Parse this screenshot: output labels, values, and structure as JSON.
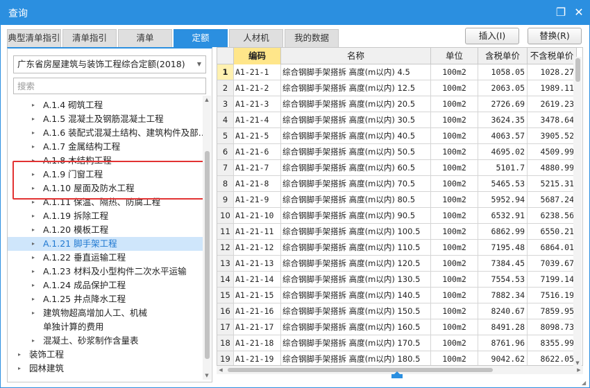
{
  "window": {
    "title": "查询",
    "restore_glyph": "❐",
    "close_glyph": "✕"
  },
  "tabs": [
    {
      "label": "典型清单指引",
      "active": false
    },
    {
      "label": "清单指引",
      "active": false
    },
    {
      "label": "清单",
      "active": false
    },
    {
      "label": "定额",
      "active": true
    },
    {
      "label": "人材机",
      "active": false
    },
    {
      "label": "我的数据",
      "active": false
    }
  ],
  "toolbar": {
    "insert_label": "插入(I)",
    "replace_label": "替换(R)"
  },
  "left": {
    "quota_library": "广东省房屋建筑与装饰工程综合定额(2018)",
    "search_placeholder": "搜索",
    "tree": [
      {
        "label": "A.1.4 砌筑工程",
        "caret": "▸",
        "indent": 1
      },
      {
        "label": "A.1.5 混凝土及钢筋混凝土工程",
        "caret": "▸",
        "indent": 1
      },
      {
        "label": "A.1.6 装配式混凝土结构、建筑构件及部…",
        "caret": "▸",
        "indent": 1
      },
      {
        "label": "A.1.7 金属结构工程",
        "caret": "▸",
        "indent": 1
      },
      {
        "label": "A.1.8 木结构工程",
        "caret": "▸",
        "indent": 1
      },
      {
        "label": "A.1.9 门窗工程",
        "caret": "▸",
        "indent": 1
      },
      {
        "label": "A.1.10 屋面及防水工程",
        "caret": "▸",
        "indent": 1
      },
      {
        "label": "A.1.11 保温、隔热、防腐工程",
        "caret": "▸",
        "indent": 1
      },
      {
        "label": "A.1.19 拆除工程",
        "caret": "▸",
        "indent": 1
      },
      {
        "label": "A.1.20 模板工程",
        "caret": "▸",
        "indent": 1
      },
      {
        "label": "A.1.21 脚手架工程",
        "caret": "▸",
        "indent": 1,
        "selected": true
      },
      {
        "label": "A.1.22 垂直运输工程",
        "caret": "▸",
        "indent": 1
      },
      {
        "label": "A.1.23 材料及小型构件二次水平运输",
        "caret": "▸",
        "indent": 1
      },
      {
        "label": "A.1.24 成品保护工程",
        "caret": "▸",
        "indent": 1
      },
      {
        "label": "A.1.25 井点降水工程",
        "caret": "▸",
        "indent": 1
      },
      {
        "label": "建筑物超高增加人工、机械",
        "caret": "▸",
        "indent": 1
      },
      {
        "label": "单独计算的费用",
        "caret": "",
        "indent": 1
      },
      {
        "label": "混凝土、砂浆制作含量表",
        "caret": "▸",
        "indent": 1
      },
      {
        "label": "装饰工程",
        "caret": "▸",
        "indent": 0
      },
      {
        "label": "园林建筑",
        "caret": "▸",
        "indent": 0
      }
    ]
  },
  "grid": {
    "columns": [
      "",
      "编码",
      "名称",
      "单位",
      "含税单价",
      "不含税单价"
    ],
    "rows": [
      {
        "n": "1",
        "code": "A1-21-1",
        "name": "综合钢脚手架搭拆 高度(m以内) 4.5",
        "unit": "100m2",
        "tax": "1058.05",
        "notax": "1028.27",
        "active": true
      },
      {
        "n": "2",
        "code": "A1-21-2",
        "name": "综合钢脚手架搭拆 高度(m以内) 12.5",
        "unit": "100m2",
        "tax": "2063.05",
        "notax": "1989.11"
      },
      {
        "n": "3",
        "code": "A1-21-3",
        "name": "综合钢脚手架搭拆 高度(m以内) 20.5",
        "unit": "100m2",
        "tax": "2726.69",
        "notax": "2619.23"
      },
      {
        "n": "4",
        "code": "A1-21-4",
        "name": "综合钢脚手架搭拆 高度(m以内) 30.5",
        "unit": "100m2",
        "tax": "3624.35",
        "notax": "3478.64"
      },
      {
        "n": "5",
        "code": "A1-21-5",
        "name": "综合钢脚手架搭拆 高度(m以内) 40.5",
        "unit": "100m2",
        "tax": "4063.57",
        "notax": "3905.52"
      },
      {
        "n": "6",
        "code": "A1-21-6",
        "name": "综合钢脚手架搭拆 高度(m以内) 50.5",
        "unit": "100m2",
        "tax": "4695.02",
        "notax": "4509.99"
      },
      {
        "n": "7",
        "code": "A1-21-7",
        "name": "综合钢脚手架搭拆 高度(m以内) 60.5",
        "unit": "100m2",
        "tax": "5101.7",
        "notax": "4880.99"
      },
      {
        "n": "8",
        "code": "A1-21-8",
        "name": "综合钢脚手架搭拆 高度(m以内) 70.5",
        "unit": "100m2",
        "tax": "5465.53",
        "notax": "5215.31"
      },
      {
        "n": "9",
        "code": "A1-21-9",
        "name": "综合钢脚手架搭拆 高度(m以内) 80.5",
        "unit": "100m2",
        "tax": "5952.94",
        "notax": "5687.24"
      },
      {
        "n": "10",
        "code": "A1-21-10",
        "name": "综合钢脚手架搭拆 高度(m以内) 90.5",
        "unit": "100m2",
        "tax": "6532.91",
        "notax": "6238.56"
      },
      {
        "n": "11",
        "code": "A1-21-11",
        "name": "综合钢脚手架搭拆 高度(m以内) 100.5",
        "unit": "100m2",
        "tax": "6862.99",
        "notax": "6550.21"
      },
      {
        "n": "12",
        "code": "A1-21-12",
        "name": "综合钢脚手架搭拆 高度(m以内) 110.5",
        "unit": "100m2",
        "tax": "7195.48",
        "notax": "6864.01"
      },
      {
        "n": "13",
        "code": "A1-21-13",
        "name": "综合钢脚手架搭拆 高度(m以内) 120.5",
        "unit": "100m2",
        "tax": "7384.45",
        "notax": "7039.67"
      },
      {
        "n": "14",
        "code": "A1-21-14",
        "name": "综合钢脚手架搭拆 高度(m以内) 130.5",
        "unit": "100m2",
        "tax": "7554.53",
        "notax": "7199.14"
      },
      {
        "n": "15",
        "code": "A1-21-15",
        "name": "综合钢脚手架搭拆 高度(m以内) 140.5",
        "unit": "100m2",
        "tax": "7882.34",
        "notax": "7516.19"
      },
      {
        "n": "16",
        "code": "A1-21-16",
        "name": "综合钢脚手架搭拆 高度(m以内) 150.5",
        "unit": "100m2",
        "tax": "8240.67",
        "notax": "7859.95"
      },
      {
        "n": "17",
        "code": "A1-21-17",
        "name": "综合钢脚手架搭拆 高度(m以内) 160.5",
        "unit": "100m2",
        "tax": "8491.28",
        "notax": "8098.73"
      },
      {
        "n": "18",
        "code": "A1-21-18",
        "name": "综合钢脚手架搭拆 高度(m以内) 170.5",
        "unit": "100m2",
        "tax": "8761.96",
        "notax": "8355.99"
      },
      {
        "n": "19",
        "code": "A1-21-19",
        "name": "综合钢脚手架搭拆 高度(m以内) 180.5",
        "unit": "100m2",
        "tax": "9042.62",
        "notax": "8622.05"
      }
    ]
  },
  "colors": {
    "accent": "#2b8fe0",
    "highlight_box": "#e23232",
    "code_header": "#ffe68a",
    "selected_row": "#cfe6fb"
  }
}
